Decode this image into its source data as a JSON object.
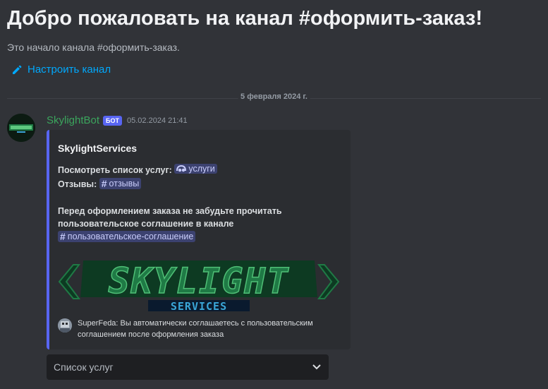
{
  "welcome": {
    "title": "Добро пожаловать на канал #оформить-заказ!",
    "subtitle": "Это начало канала #оформить-заказ.",
    "setup_link": "Настроить канал"
  },
  "divider": {
    "date": "5 февраля 2024 г."
  },
  "message": {
    "author": "SkylightBot",
    "badge": "БОТ",
    "timestamp": "05.02.2024 21:41",
    "embed": {
      "accent": "#5865f2",
      "title": "SkylightServices",
      "line1_prefix": "Посмотреть список услуг:",
      "line1_mention": "услуги",
      "line2_prefix": "Отзывы:",
      "line2_mention": "отзывы",
      "notice_line1": "Перед оформлением заказа не забудьте прочитать",
      "notice_line2": "пользовательское соглашение в канале",
      "notice_mention": "пользовательское-соглашение",
      "image_logo": "SKYLIGHT",
      "image_sub": "SERVICES",
      "footer_line1": "SuperFeda: Вы автоматически соглашаетесь с пользовательским",
      "footer_line2": "соглашением после оформления заказа"
    },
    "select": {
      "label": "Список услуг"
    }
  },
  "colors": {
    "background": "#313338",
    "link": "#00a8fc",
    "author": "#3ba55d",
    "mention_bg": "#3c4270",
    "logo_green": "#1f7a45"
  },
  "icons": [
    "pencil-icon",
    "voice-channel-icon",
    "hash-icon",
    "chevron-down-icon"
  ]
}
